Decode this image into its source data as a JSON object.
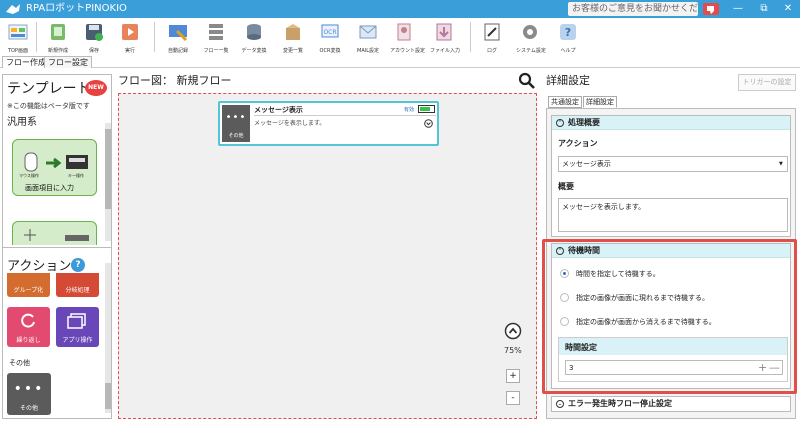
{
  "window": {
    "title": "RPAロボットPINOKIO",
    "feedback": "お客様のご意見をお聞かせください"
  },
  "toolbar": {
    "buttons": [
      {
        "label": "TOP画面"
      },
      {
        "label": "新規作成"
      },
      {
        "label": "保存"
      },
      {
        "label": "実行"
      },
      {
        "label": "自動記録"
      },
      {
        "label": "フロー一覧"
      },
      {
        "label": "データ変換"
      },
      {
        "label": "変更一覧"
      },
      {
        "label": "OCR変換"
      },
      {
        "label": "MAIL設定"
      },
      {
        "label": "アカウント設定"
      },
      {
        "label": "ファイル入力"
      },
      {
        "label": "ログ"
      },
      {
        "label": "システム設定"
      },
      {
        "label": "ヘルプ"
      }
    ]
  },
  "main_tabs": [
    {
      "label": "フロー作成"
    },
    {
      "label": "フロー設定"
    }
  ],
  "left_panel": {
    "template_title": "テンプレート",
    "new_badge": "NEW",
    "beta_note": "※この機能はベータ版です",
    "category": "汎用系",
    "template_card_1": {
      "label": "画面項目に入力",
      "left_icon_label": "マウス操作",
      "right_icon_label": "キー操作"
    },
    "action_title": "アクション",
    "action_cards": [
      {
        "label": "グループ化"
      },
      {
        "label": "分岐処理"
      },
      {
        "label": "繰り返し"
      },
      {
        "label": "アプリ操作"
      }
    ],
    "other_category": "その他",
    "other_card": {
      "label": "その他"
    }
  },
  "flow": {
    "header": "フロー図： 新規フロー",
    "zoom": "75%",
    "node": {
      "title": "メッセージ表示",
      "status": "有効",
      "description": "メッセージを表示します。",
      "icon_label": "その他"
    },
    "zoom_in": "+",
    "zoom_out": "-"
  },
  "detail": {
    "header": "詳細設定",
    "trigger_button": "トリガーの設定",
    "tabs": [
      {
        "label": "共通設定"
      },
      {
        "label": "詳細設定"
      }
    ],
    "section1": {
      "title": "処理概要",
      "action_label": "アクション",
      "action_value": "メッセージ表示",
      "summary_label": "概要",
      "summary_value": "メッセージを表示します。"
    },
    "section2": {
      "title": "待機時間",
      "options": [
        {
          "label": "時間を指定して待機する。",
          "selected": true
        },
        {
          "label": "指定の画像が画面に現れるまで待機する。",
          "selected": false
        },
        {
          "label": "指定の画像が画面から消えるまで待機する。",
          "selected": false
        }
      ],
      "time_label": "時間設定",
      "time_value": "3"
    },
    "section3": {
      "title": "エラー発生時フロー停止設定"
    }
  },
  "colors": {
    "titlebar": "#3a9fd9",
    "accent_teal": "#52c5d6",
    "highlight": "#e0504a",
    "template_green": "#d4ecc9",
    "action_orange": "#d46b2f",
    "action_pink": "#e34a70",
    "action_purple": "#6a47b8",
    "other_gray": "#5b5b5b"
  }
}
